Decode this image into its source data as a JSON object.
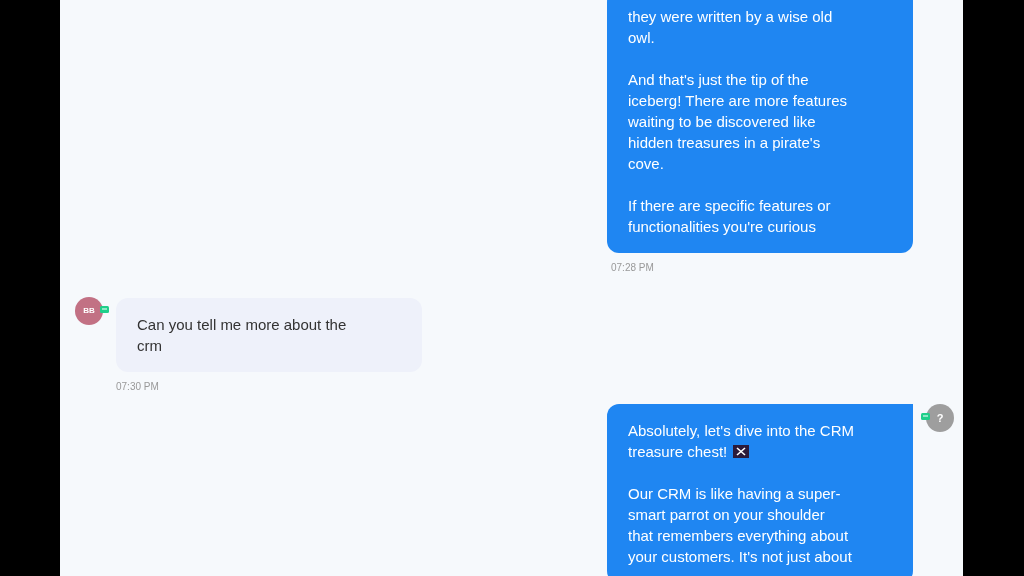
{
  "messages": [
    {
      "kind": "outgoing",
      "paragraphs": [
        [
          "they were written by a wise old",
          "owl."
        ],
        [
          "And that's just the tip of the",
          "iceberg! There are more features",
          "waiting to be discovered like",
          "hidden treasures in a pirate's",
          "cove."
        ],
        [
          "If there are specific features or",
          "functionalities you're curious"
        ]
      ],
      "time": "07:28 PM",
      "flag_emoji": false
    },
    {
      "kind": "incoming",
      "avatar": "BB",
      "paragraphs": [
        [
          "Can you tell me more about the",
          "crm"
        ]
      ],
      "time": "07:30 PM",
      "flag_emoji": false
    },
    {
      "kind": "outgoing",
      "avatar": "?",
      "paragraphs": [
        [
          "Absolutely, let's dive into the CRM",
          "treasure chest!"
        ],
        [
          "Our CRM is like having a super-",
          "smart parrot on your shoulder",
          "that remembers everything about",
          "your customers. It's not just about"
        ]
      ],
      "flag_emoji": true
    }
  ]
}
